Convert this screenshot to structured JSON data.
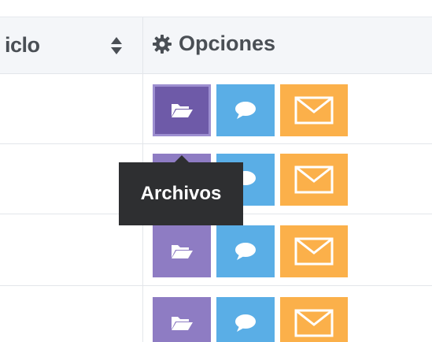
{
  "table": {
    "columns": [
      {
        "label": "iclo",
        "sortable": true
      },
      {
        "label": "Opciones",
        "icon": "gear-icon"
      }
    ],
    "rows": [
      {
        "actions": [
          "folder-open-icon",
          "comment-icon",
          "envelope-icon"
        ]
      },
      {
        "actions": [
          "folder-open-icon",
          "comment-icon",
          "envelope-icon"
        ]
      },
      {
        "actions": [
          "folder-open-icon",
          "comment-icon",
          "envelope-icon"
        ]
      },
      {
        "actions": [
          "folder-open-icon",
          "comment-icon",
          "envelope-icon"
        ]
      }
    ]
  },
  "tooltip": {
    "text": "Archivos"
  },
  "colors": {
    "files": "#8e7cc3",
    "files_active": "#6e5aa8",
    "comment": "#5aaee6",
    "mail": "#fbb04a",
    "header_bg": "#f4f6f9",
    "header_text": "#4a4f55",
    "tooltip_bg": "#2e2f31"
  }
}
